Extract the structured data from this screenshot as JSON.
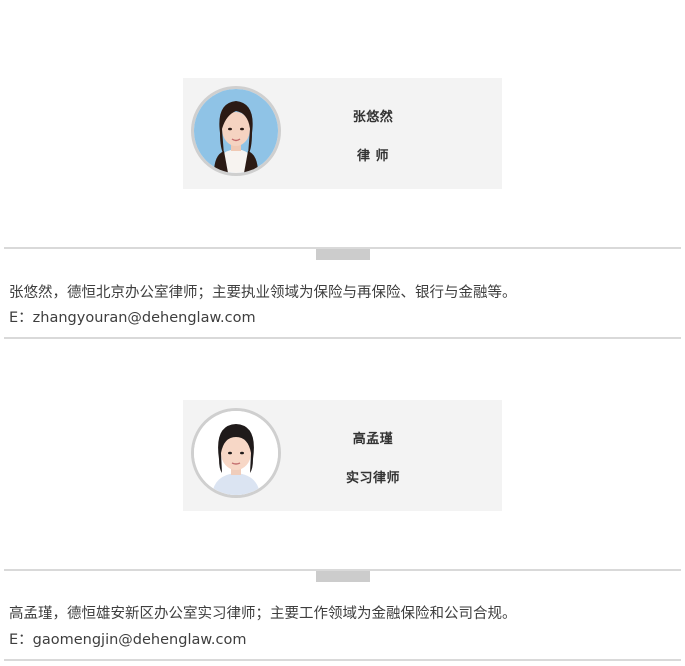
{
  "profiles": [
    {
      "name": "张悠然",
      "title": "律 师",
      "bio": "张悠然，德恒北京办公室律师；主要执业领域为保险与再保险、银行与金融等。",
      "email": "E：zhangyouran@dehenglaw.com",
      "avatar_bg": "#8fc3e6"
    },
    {
      "name": "高孟瑾",
      "title": "实习律师",
      "bio": "高孟瑾，德恒雄安新区办公室实习律师；主要工作领域为金融保险和公司合规。",
      "email": "E：gaomengjin@dehenglaw.com",
      "avatar_bg": "#ffffff"
    }
  ]
}
